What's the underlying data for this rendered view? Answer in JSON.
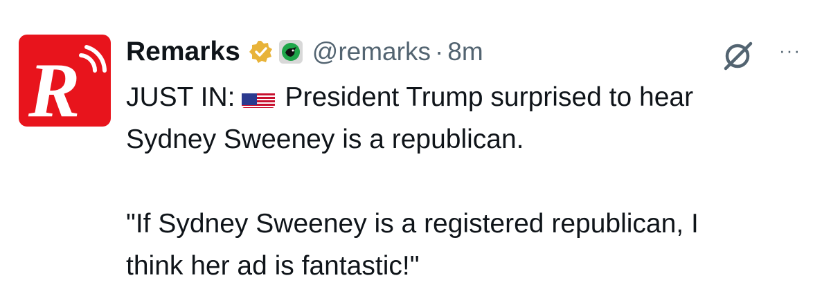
{
  "post": {
    "author_name": "Remarks",
    "handle": "@remarks",
    "separator": "·",
    "time": "8m",
    "avatar_letter": "R",
    "icons": {
      "verified": "verified-badge-icon",
      "affiliate": "affiliate-badge-icon",
      "grok": "grok-icon",
      "more": "more-options-icon",
      "flag": "us-flag-emoji"
    },
    "more_label": "···",
    "text": {
      "line1_prefix": "JUST IN:",
      "line1_suffix": "President Trump surprised to hear",
      "line2": "Sydney Sweeney is a republican.",
      "line3": "\"If Sydney Sweeney is a registered republican, I",
      "line4": "think her ad is fantastic!\""
    }
  },
  "colors": {
    "avatar_bg": "#e8141c",
    "verified_gold": "#e8b339",
    "text_primary": "#0f1419",
    "text_secondary": "#536471"
  }
}
